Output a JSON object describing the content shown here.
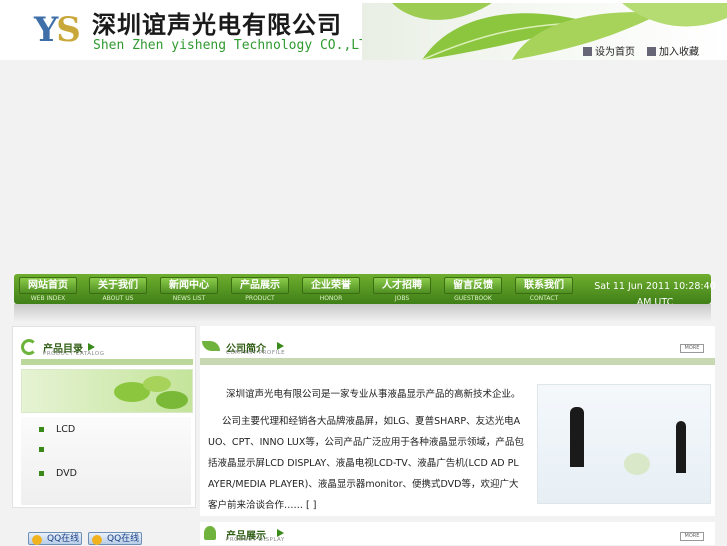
{
  "header": {
    "logo_text": "YS",
    "company_name_cn": "深圳谊声光电有限公司",
    "company_name_en": "Shen Zhen yisheng Technology CO.,LTD",
    "tools": [
      {
        "icon": "home-icon",
        "label": "设为首页"
      },
      {
        "icon": "star-icon",
        "label": "加入收藏"
      }
    ]
  },
  "nav": {
    "items": [
      {
        "cn": "网站首页",
        "en": "WEB INDEX"
      },
      {
        "cn": "关于我们",
        "en": "ABOUT US"
      },
      {
        "cn": "新闻中心",
        "en": "NEWS LIST"
      },
      {
        "cn": "产品展示",
        "en": "PRODUCT"
      },
      {
        "cn": "企业荣誉",
        "en": "HONOR"
      },
      {
        "cn": "人才招聘",
        "en": "JOBS"
      },
      {
        "cn": "留言反馈",
        "en": "GUESTBOOK"
      },
      {
        "cn": "联系我们",
        "en": "CONTACT"
      }
    ],
    "datetime": "Sat 11 Jun 2011 10:28:40 AM UTC"
  },
  "sidebar": {
    "title_cn": "产品目录",
    "title_en": "PRODUCT CATALOG",
    "items": [
      {
        "label": "LCD"
      },
      {
        "label": ""
      },
      {
        "label": "DVD"
      }
    ]
  },
  "about": {
    "title_cn": "公司简介",
    "title_en": "COMPANY PROFILE",
    "more": "MORE",
    "paragraph1": "深圳谊声光电有限公司是一家专业从事液晶显示产品的高新技术企业。",
    "paragraph2": "公司主要代理和经销各大品牌液晶屏，如LG、夏普SHARP、友达光电AUO、CPT、INNO LUX等，公司产品广泛应用于各种液晶显示领域，产品包括液晶显示屏LCD DISPLAY、液晶电视LCD-TV、液晶广告机(LCD AD PLAYER/MEDIA PLAYER)、液晶显示器monitor、便携式DVD等，欢迎广大客户前来洽谈合作……",
    "more_link": "[ ]"
  },
  "products": {
    "title_cn": "产品展示",
    "title_en": "PRODUCT DISPLAY",
    "more": "MORE"
  },
  "qq": {
    "buttons": [
      {
        "label": "QQ在线"
      },
      {
        "label": "QQ在线"
      }
    ]
  }
}
